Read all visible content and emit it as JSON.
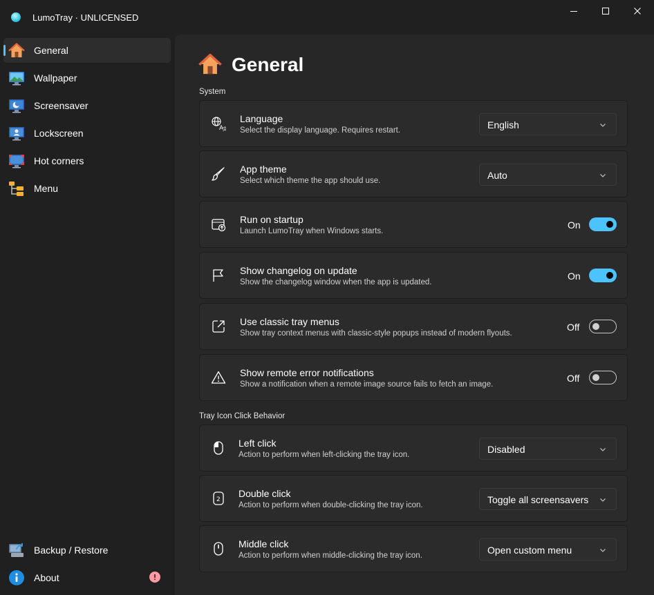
{
  "window": {
    "title": "LumoTray · UNLICENSED"
  },
  "sidebar": {
    "items": [
      {
        "label": "General",
        "icon": "home-icon",
        "selected": true
      },
      {
        "label": "Wallpaper",
        "icon": "wallpaper-icon"
      },
      {
        "label": "Screensaver",
        "icon": "screensaver-icon"
      },
      {
        "label": "Lockscreen",
        "icon": "lockscreen-icon"
      },
      {
        "label": "Hot corners",
        "icon": "hot-corners-icon"
      },
      {
        "label": "Menu",
        "icon": "menu-tree-icon"
      }
    ],
    "footer_items": [
      {
        "label": "Backup / Restore",
        "icon": "backup-icon"
      },
      {
        "label": "About",
        "icon": "info-icon",
        "badge": "!"
      }
    ],
    "accent_color": "#4cc2ff"
  },
  "page": {
    "title": "General",
    "sections": [
      {
        "header": "System",
        "settings": [
          {
            "title": "Language",
            "description": "Select the display language. Requires restart.",
            "control": "dropdown",
            "value": "English",
            "icon": "language-icon"
          },
          {
            "title": "App theme",
            "description": "Select which theme the app should use.",
            "control": "dropdown",
            "value": "Auto",
            "icon": "brush-icon"
          },
          {
            "title": "Run on startup",
            "description": "Launch LumoTray when Windows starts.",
            "control": "toggle",
            "state": "On",
            "icon": "startup-icon"
          },
          {
            "title": "Show changelog on update",
            "description": "Show the changelog window when the app is updated.",
            "control": "toggle",
            "state": "On",
            "icon": "flag-icon"
          },
          {
            "title": "Use classic tray menus",
            "description": "Show tray context menus with classic-style popups instead of modern flyouts.",
            "control": "toggle",
            "state": "Off",
            "icon": "open-external-icon"
          },
          {
            "title": "Show remote error notifications",
            "description": "Show a notification when a remote image source fails to fetch an image.",
            "control": "toggle",
            "state": "Off",
            "icon": "warning-icon"
          }
        ]
      },
      {
        "header": "Tray Icon Click Behavior",
        "settings": [
          {
            "title": "Left click",
            "description": "Action to perform when left-clicking the tray icon.",
            "control": "dropdown",
            "value": "Disabled",
            "icon": "mouse-left-icon"
          },
          {
            "title": "Double click",
            "description": "Action to perform when double-clicking the tray icon.",
            "control": "dropdown",
            "value": "Toggle all screensavers",
            "icon": "mouse-double-icon"
          },
          {
            "title": "Middle click",
            "description": "Action to perform when middle-clicking the tray icon.",
            "control": "dropdown",
            "value": "Open custom menu",
            "icon": "mouse-middle-icon"
          }
        ]
      }
    ]
  }
}
